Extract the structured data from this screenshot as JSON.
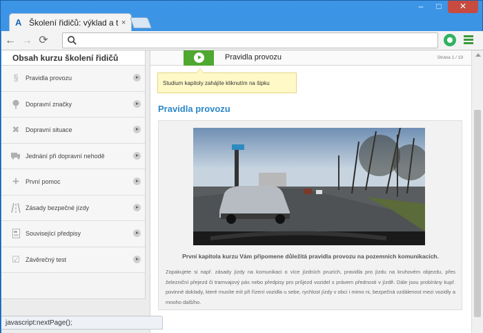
{
  "browser": {
    "tab_title": "Školení řidičů: výklad a tes",
    "tab_close": "×",
    "window_controls": {
      "minimize": "–",
      "maximize": "□",
      "close": "✕"
    },
    "nav": {
      "back": "←",
      "forward": "→",
      "reload": "⟳"
    },
    "omnibox_value": "",
    "status_url": "javascript:nextPage();"
  },
  "sidebar": {
    "title": "Obsah kurzu školení řidičů",
    "items": [
      {
        "label": "Pravidla provozu",
        "icon": "paragraph-icon"
      },
      {
        "label": "Dopravní značky",
        "icon": "sign-icon"
      },
      {
        "label": "Dopravní situace",
        "icon": "cross-icon"
      },
      {
        "label": "Jednání při dopravní nehodě",
        "icon": "truck-icon"
      },
      {
        "label": "První pomoc",
        "icon": "plus-icon"
      },
      {
        "label": "Zásady bezpečné jízdy",
        "icon": "road-icon"
      },
      {
        "label": "Související předpisy",
        "icon": "document-icon"
      },
      {
        "label": "Závěrečný test",
        "icon": "checkbox-icon"
      }
    ]
  },
  "main": {
    "header_title": "Pravidla provozu",
    "page_counter": "Strana 1 / 19",
    "tooltip": "Studium kapitoly zahájíte kliknutím na šipku",
    "section_heading": "Pravidla provozu",
    "intro": "První kapitola kurzu Vám připomene důležitá pravidla provozu na pozemních komunikacích.",
    "body": "Zopakujete si např. zásady jízdy na komunikaci o více jízdních pruzích, pravidla pro jízdu na kruhovém objezdu, přes železniční přejezd či tramvajový pás nebo předpisy pro průjezd vozidel s právem přednosti v jízdě. Dále jsou probírány kupř. povinné doklady, které musíte mít při řízení vozidla u sebe, rychlost jízdy v obci i mimo ni, bezpečná vzdálenost mezi vozidly a mnoho dalšího."
  },
  "colors": {
    "accent_blue": "#2c87c7",
    "play_green": "#4fa82f",
    "tooltip_bg": "#fff9c7"
  }
}
